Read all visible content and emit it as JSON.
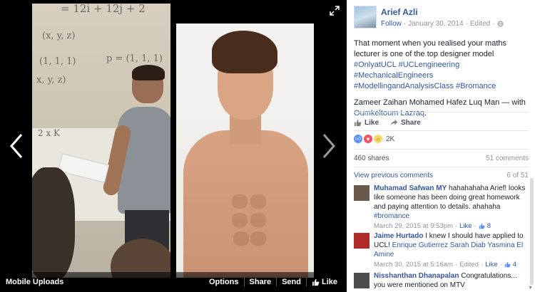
{
  "viewer": {
    "album_label": "Mobile Uploads",
    "options_label": "Options",
    "share_label": "Share",
    "send_label": "Send",
    "like_label": "Like"
  },
  "post": {
    "author": "Arief Azli",
    "follow_label": "Follow",
    "date": "January 30, 2014",
    "edited_label": "Edited",
    "text_plain": "That moment when you realised your maths lecturer is one of the top designer model ",
    "hashtags": [
      "#OnlyatUCL",
      "#UCLengineering",
      "#MechanicalEngineers",
      "#ModellingandAnalysisClass",
      "#Bromance"
    ],
    "tagged": "Zameer Zaihan Mohamed Hafez Luq Man",
    "with_label": " — with ",
    "with_person": "Oumkeltoum Lazraq",
    "with_end": ".",
    "like_action": "Like",
    "share_action": "Share",
    "reactions_count": "2K",
    "shares": "460 shares",
    "comments": "51 comments",
    "view_previous": "View previous comments",
    "comment_page": "6 of 51"
  },
  "comments": [
    {
      "name": "Muhamad Safwan MY",
      "text": " hahahahaha Arief! looks like someone has been doing great homework and paying attention to details. ahahaha ",
      "link": "#bromance",
      "time": "March 29, 2015 at 9:53pm",
      "like": "Like",
      "likes": "8"
    },
    {
      "name": "Jaime Hurtado",
      "text": " I knew I should have applied to UCL! ",
      "link": "Enrique Gutierrez Sarah Diab Yasmina El Amine",
      "time": "March 30, 2015 at 5:16am",
      "edited": "Edited",
      "like": "Like",
      "likes": "4"
    },
    {
      "name": "Nisshanthan Dhanapalan",
      "text": " Congratulations... you were mentioned on MTV",
      "link": "",
      "time": "",
      "like": "",
      "likes": ""
    }
  ],
  "board": {
    "line1": "= 12i + 12j + 2",
    "line2": "(x, y, z)",
    "line3": "(1, 1, 1)",
    "line4": "p = (1, 1, 1)",
    "line5": "x, y, z)",
    "line6": "2 x K"
  },
  "colors": {
    "fb_blue": "#365899",
    "panel_bg": "#ffffff",
    "stage_bg": "#000000"
  }
}
